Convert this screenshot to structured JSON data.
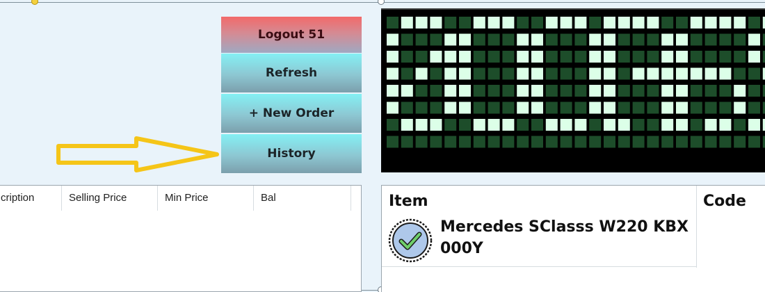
{
  "buttons": {
    "logout_label": "Logout 51",
    "refresh_label": "Refresh",
    "new_order_label": "+ New Order",
    "history_label": "History"
  },
  "annotation": {
    "arrow_color": "#f5c518",
    "arrow_points_to": "History"
  },
  "led_display": {
    "background_color": "#000000",
    "lit_color": "#dcffe8",
    "dim_color": "#1d4d2a",
    "state": "scrolling dot-matrix text (partially visible)"
  },
  "left_table": {
    "columns": [
      "cription",
      "Selling Price",
      "Min Price",
      "Bal"
    ],
    "rows": []
  },
  "right_table": {
    "columns": [
      "Item",
      "Code"
    ],
    "rows": [
      {
        "item": "Mercedes SClasss W220 KBX 000Y",
        "code": "",
        "icon": "check-circle-icon"
      }
    ]
  },
  "colors": {
    "logout_top": "#f26a6a",
    "button_cyan": "#84f0f4",
    "window_bg": "#e9f3fa"
  }
}
